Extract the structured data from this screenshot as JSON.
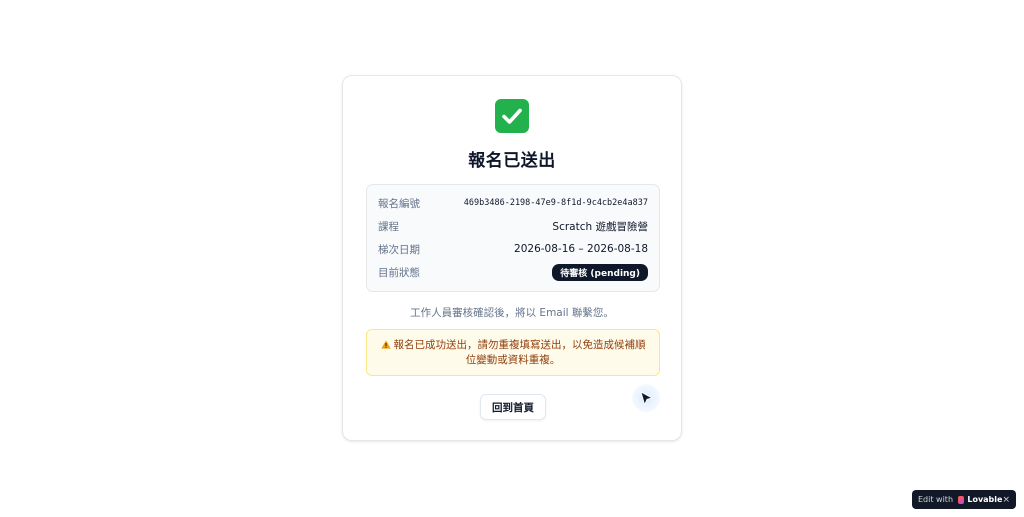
{
  "card": {
    "title": "報名已送出",
    "details": [
      {
        "label": "報名編號",
        "value": "469b3486-2198-47e9-8f1d-9c4cb2e4a837"
      },
      {
        "label": "課程",
        "value": "Scratch 遊戲冒險營"
      },
      {
        "label": "梯次日期",
        "value": "2026-08-16 – 2026-08-18"
      },
      {
        "label": "目前狀態",
        "value": "待審核 (pending)"
      }
    ],
    "notice": "工作人員審核確認後，將以 Email 聯繫您。",
    "warning": "報名已成功送出，請勿重複填寫送出，以免造成候補順位變動或資料重複。",
    "home_button": "回到首頁"
  },
  "icons": {
    "success": "check-mark-button-icon",
    "warning": "warning-icon",
    "cursor": "pointer-cursor-icon"
  },
  "colors": {
    "success_green": "#22b14c",
    "status_badge": "#0f172a",
    "warning_bg": "#fffbeb",
    "warning_text": "#92400e"
  },
  "lovable_badge": {
    "edit_label": "Edit with",
    "brand": "Lovable",
    "close": "×"
  }
}
